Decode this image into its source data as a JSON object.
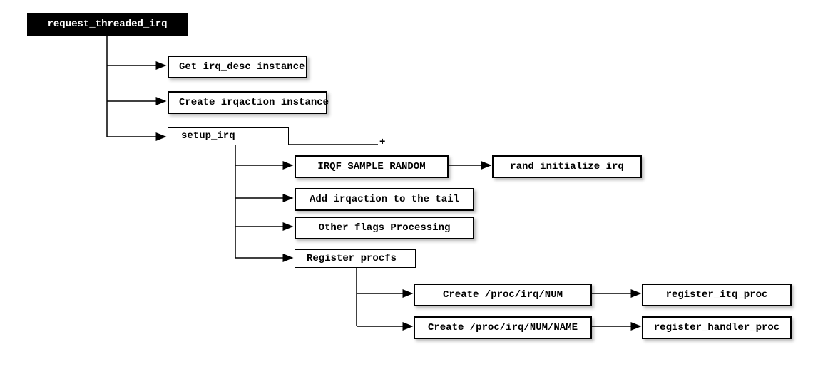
{
  "root": {
    "label": "request_threaded_irq"
  },
  "level1": {
    "item0": "Get irq_desc instance",
    "item1": "Create irqaction instance",
    "item2": "setup_irq"
  },
  "expand": {
    "symbol": "+"
  },
  "level2": {
    "item0": "IRQF_SAMPLE_RANDOM",
    "item1": "Add irqaction to the tail",
    "item2": "Other flags Processing",
    "item3": "Register procfs"
  },
  "level2_side": {
    "item0": "rand_initialize_irq"
  },
  "level3": {
    "item0": "Create /proc/irq/NUM",
    "item1": "Create /proc/irq/NUM/NAME"
  },
  "level3_side": {
    "item0": "register_itq_proc",
    "item1": "register_handler_proc"
  },
  "chart_data": {
    "type": "tree",
    "title": "request_threaded_irq call flow",
    "nodes": [
      {
        "id": "root",
        "label": "request_threaded_irq",
        "children": [
          "a",
          "b",
          "c"
        ]
      },
      {
        "id": "a",
        "label": "Get irq_desc instance"
      },
      {
        "id": "b",
        "label": "Create irqaction instance"
      },
      {
        "id": "c",
        "label": "setup_irq",
        "children": [
          "c1",
          "c2",
          "c3",
          "c4"
        ],
        "expandable": true
      },
      {
        "id": "c1",
        "label": "IRQF_SAMPLE_RANDOM",
        "children": [
          "c1a"
        ]
      },
      {
        "id": "c1a",
        "label": "rand_initialize_irq"
      },
      {
        "id": "c2",
        "label": "Add irqaction to the tail"
      },
      {
        "id": "c3",
        "label": "Other flags Processing"
      },
      {
        "id": "c4",
        "label": "Register procfs",
        "children": [
          "c4a",
          "c4b"
        ]
      },
      {
        "id": "c4a",
        "label": "Create /proc/irq/NUM",
        "children": [
          "c4a1"
        ]
      },
      {
        "id": "c4a1",
        "label": "register_itq_proc"
      },
      {
        "id": "c4b",
        "label": "Create /proc/irq/NUM/NAME",
        "children": [
          "c4b1"
        ]
      },
      {
        "id": "c4b1",
        "label": "register_handler_proc"
      }
    ]
  }
}
